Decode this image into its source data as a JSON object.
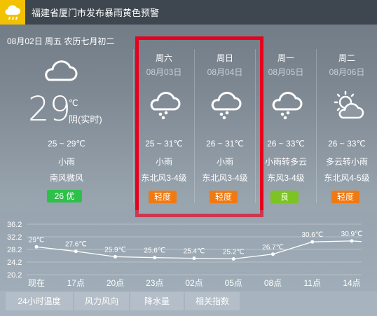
{
  "alert": {
    "text": "福建省厦门市发布暴雨黄色预警",
    "icon": "rain-alert-icon"
  },
  "date_line": "08月02日 周五 农历七月初二",
  "current": {
    "icon": "cloud-icon",
    "temp": "29",
    "unit": "℃",
    "desc": "阴(实时)",
    "range": "25 ~ 29℃",
    "weather": "小雨",
    "wind": "南风微风",
    "aqi": "26 优",
    "aqi_color": "#2ec04a"
  },
  "days": [
    {
      "name": "周六",
      "date": "08月03日",
      "icon": "rain-cloud-icon",
      "range": "25 ~ 31℃",
      "weather": "小雨",
      "wind": "东北风3-4级",
      "aqi": "轻度",
      "aqi_color": "#f07a12"
    },
    {
      "name": "周日",
      "date": "08月04日",
      "icon": "rain-cloud-icon",
      "range": "26 ~ 31℃",
      "weather": "小雨",
      "wind": "东北风3-4级",
      "aqi": "轻度",
      "aqi_color": "#f07a12"
    },
    {
      "name": "周一",
      "date": "08月05日",
      "icon": "rain-cloud-icon",
      "range": "26 ~ 33℃",
      "weather": "小雨转多云",
      "wind": "东风3-4级",
      "aqi": "良",
      "aqi_color": "#7cc424"
    },
    {
      "name": "周二",
      "date": "08月06日",
      "icon": "sun-cloud-icon",
      "range": "26 ~ 33℃",
      "weather": "多云转小雨",
      "wind": "东北风4-5级",
      "aqi": "轻度",
      "aqi_color": "#f07a12"
    }
  ],
  "chart_data": {
    "type": "line",
    "categories": [
      "现在",
      "17点",
      "20点",
      "23点",
      "02点",
      "05点",
      "08点",
      "11点",
      "14点"
    ],
    "values": [
      29,
      27.6,
      25.9,
      25.6,
      25.4,
      25.2,
      26.7,
      30.6,
      30.9
    ],
    "data_labels": [
      "29℃",
      "27.6℃",
      "25.9℃",
      "25.6℃",
      "25.4℃",
      "25.2℃",
      "26.7℃",
      "30.6℃",
      "30.9℃"
    ],
    "y_ticks": [
      "36.2",
      "32.2",
      "28.2",
      "24.2",
      "20.2"
    ],
    "ylim": [
      20.2,
      36.2
    ],
    "grid": true
  },
  "tabs": [
    "24小时温度",
    "风力风向",
    "降水量",
    "相关指数"
  ]
}
